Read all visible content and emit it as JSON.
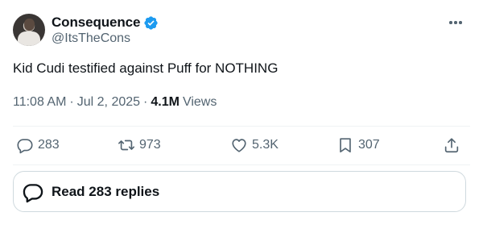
{
  "author": {
    "display_name": "Consequence",
    "handle": "@ItsTheCons",
    "verified": true,
    "verified_color": "#1d9bf0"
  },
  "tweet": {
    "text": "Kid Cudi testified against Puff for NOTHING",
    "time": "11:08 AM",
    "date": "Jul 2, 2025",
    "views_count": "4.1M",
    "views_label": "Views"
  },
  "actions": {
    "reply_count": "283",
    "retweet_count": "973",
    "like_count": "5.3K",
    "bookmark_count": "307"
  },
  "replies_button": {
    "label": "Read 283 replies"
  },
  "icons": [
    "more-icon",
    "reply-icon",
    "retweet-icon",
    "like-icon",
    "bookmark-icon",
    "share-icon",
    "replies-bubble-icon",
    "verified-icon"
  ],
  "colors": {
    "text": "#0f1419",
    "secondary": "#536471",
    "border": "#cfd9de",
    "divider": "#eff3f4"
  }
}
